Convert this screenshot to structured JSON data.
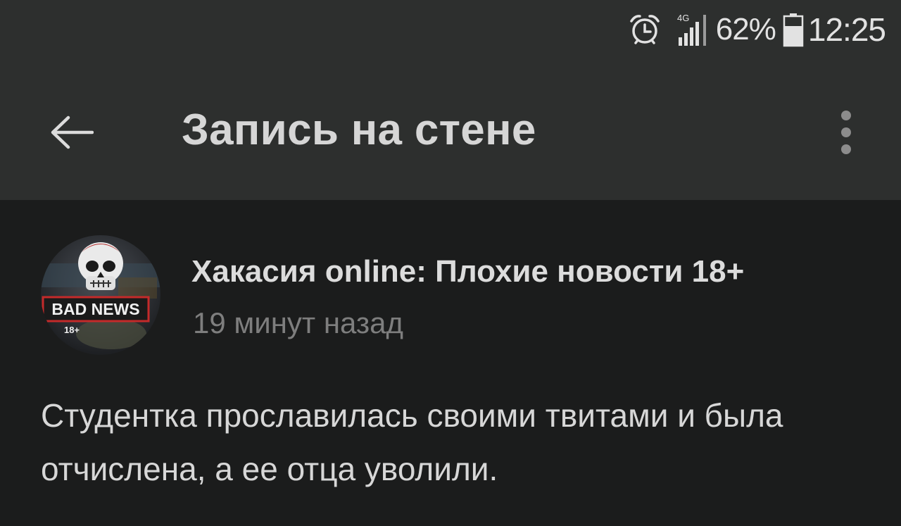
{
  "status_bar": {
    "alarm_icon": "alarm-clock-icon",
    "network_type": "4G",
    "signal_icon": "cellular-signal-icon",
    "battery_percent": "62%",
    "battery_icon": "battery-icon",
    "time": "12:25",
    "color": "#e2e2e2"
  },
  "toolbar": {
    "back_icon": "arrow-left-icon",
    "title": "Запись на стене",
    "more_icon": "more-vertical-icon",
    "background": "#2d2f2e"
  },
  "post": {
    "avatar": {
      "badge_text": "BAD NEWS",
      "age_text": "18+",
      "icon": "skull-icon"
    },
    "author": "Хакасия online: Плохие новости 18+",
    "time": "19 минут назад",
    "text": "Студентка прославилась своими твитами и была отчислена, а ее отца уволили."
  },
  "colors": {
    "page_background": "#1b1c1c",
    "text_primary": "#d7d7d7",
    "text_secondary": "#7e7e7e"
  }
}
